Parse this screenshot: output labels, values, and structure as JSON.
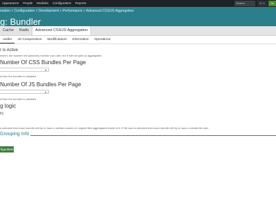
{
  "toolbar": {
    "menu": [
      "Appearance",
      "People",
      "Modules",
      "Configuration",
      "Reports"
    ],
    "search_placeholder": "Search",
    "counter": "0 / 1",
    "user": "Ja"
  },
  "header": {
    "breadcrumb": "mation » Configuration » Development » Performance » Advanced CSS/JS Aggregation",
    "title": "g: Bundler"
  },
  "tabs_primary": [
    "Cache",
    "Radix",
    "Advanced CSS/JS Aggregation"
  ],
  "tabs_secondary": [
    "undler",
    "JS Compression",
    "Modifications",
    "Information",
    "Operations"
  ],
  "form": {
    "is_active_label": "r Is Active",
    "is_active_desc": "ecked, the bundler will passively monitor your site, but it will not split up aggregates.",
    "css_heading": "Number Of CSS Bundles Per Page",
    "css_desc": "d then the bundler is disabled",
    "js_heading": "Number Of JS Bundles Per Page",
    "js_desc": "d then the bundler is disabled",
    "logic_heading": "g logic",
    "logic_option": "rs",
    "logic_desc": "s selected then each bundle will try to have a similar number of original files aggregated inside of it. If file size is selected then each bundle will try to have a similar file size.",
    "grouping_legend": "Grouping Info",
    "save_label": "figuration"
  },
  "colors": {
    "toolbar_bg": "#1e2226",
    "header_bg": "#2a7f8b",
    "save_bg": "#3f7f3d"
  }
}
